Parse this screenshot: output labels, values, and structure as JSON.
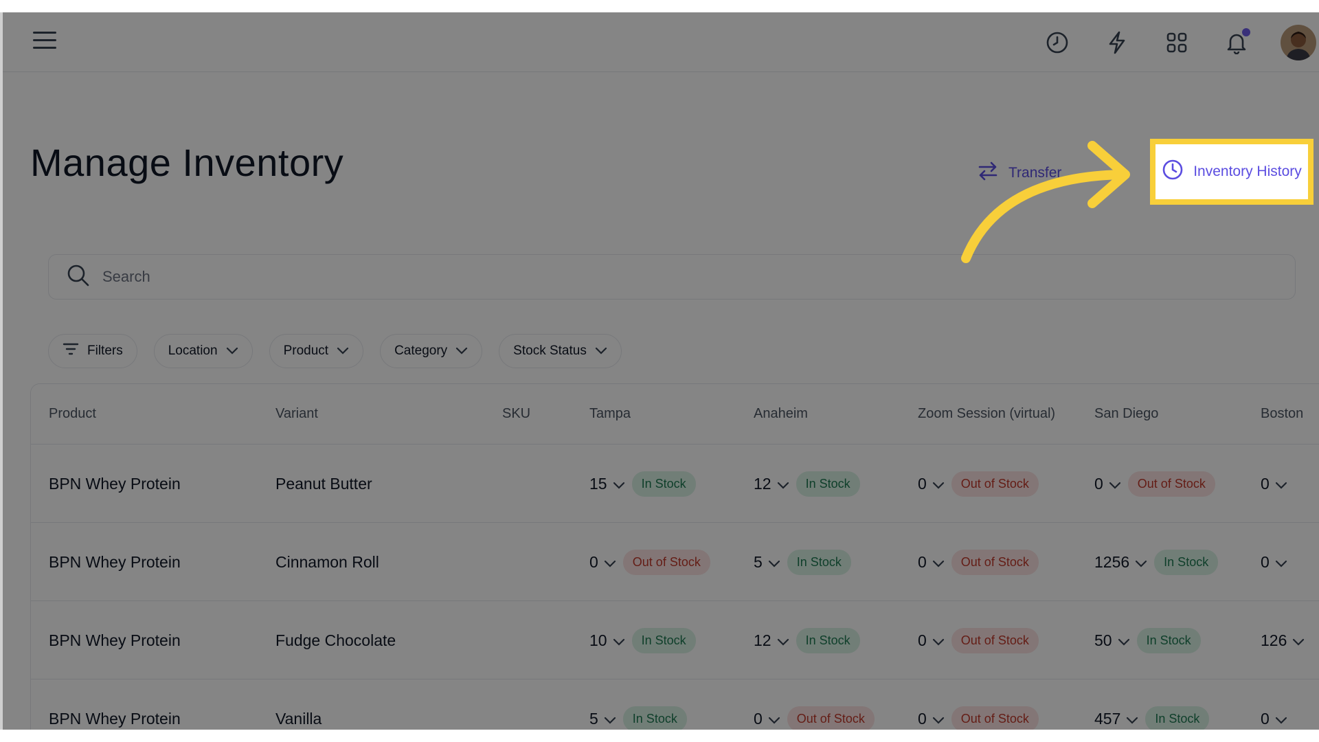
{
  "header": {
    "icons": [
      "menu-icon",
      "clock-icon",
      "lightning-icon",
      "apps-grid-icon",
      "bell-icon"
    ],
    "accent_color": "#6d5ce8"
  },
  "page": {
    "title": "Manage Inventory",
    "transfer_label": "Transfer",
    "history_label": "Inventory History"
  },
  "search": {
    "placeholder": "Search"
  },
  "filters": {
    "filters_label": "Filters",
    "location_label": "Location",
    "product_label": "Product",
    "category_label": "Category",
    "stock_status_label": "Stock Status"
  },
  "table": {
    "headers": {
      "product": "Product",
      "variant": "Variant",
      "sku": "SKU",
      "tampa": "Tampa",
      "anaheim": "Anaheim",
      "zoom": "Zoom Session (virtual)",
      "sandiego": "San Diego",
      "boston": "Boston"
    },
    "rows": [
      {
        "product": "BPN Whey Protein",
        "variant": "Peanut Butter",
        "sku": "",
        "tampa": {
          "qty": "15",
          "status": "In Stock"
        },
        "anaheim": {
          "qty": "12",
          "status": "In Stock"
        },
        "zoom": {
          "qty": "0",
          "status": "Out of Stock"
        },
        "sandiego": {
          "qty": "0",
          "status": "Out of Stock"
        },
        "boston": {
          "qty": "0"
        }
      },
      {
        "product": "BPN Whey Protein",
        "variant": "Cinnamon Roll",
        "sku": "",
        "tampa": {
          "qty": "0",
          "status": "Out of Stock"
        },
        "anaheim": {
          "qty": "5",
          "status": "In Stock"
        },
        "zoom": {
          "qty": "0",
          "status": "Out of Stock"
        },
        "sandiego": {
          "qty": "1256",
          "status": "In Stock"
        },
        "boston": {
          "qty": "0"
        }
      },
      {
        "product": "BPN Whey Protein",
        "variant": "Fudge Chocolate",
        "sku": "",
        "tampa": {
          "qty": "10",
          "status": "In Stock"
        },
        "anaheim": {
          "qty": "12",
          "status": "In Stock"
        },
        "zoom": {
          "qty": "0",
          "status": "Out of Stock"
        },
        "sandiego": {
          "qty": "50",
          "status": "In Stock"
        },
        "boston": {
          "qty": "126"
        }
      },
      {
        "product": "BPN Whey Protein",
        "variant": "Vanilla",
        "sku": "",
        "tampa": {
          "qty": "5",
          "status": "In Stock"
        },
        "anaheim": {
          "qty": "0",
          "status": "Out of Stock"
        },
        "zoom": {
          "qty": "0",
          "status": "Out of Stock"
        },
        "sandiego": {
          "qty": "457",
          "status": "In Stock"
        },
        "boston": {
          "qty": "0"
        }
      }
    ]
  },
  "annotation": {
    "highlight_color": "#f8cf3a"
  }
}
